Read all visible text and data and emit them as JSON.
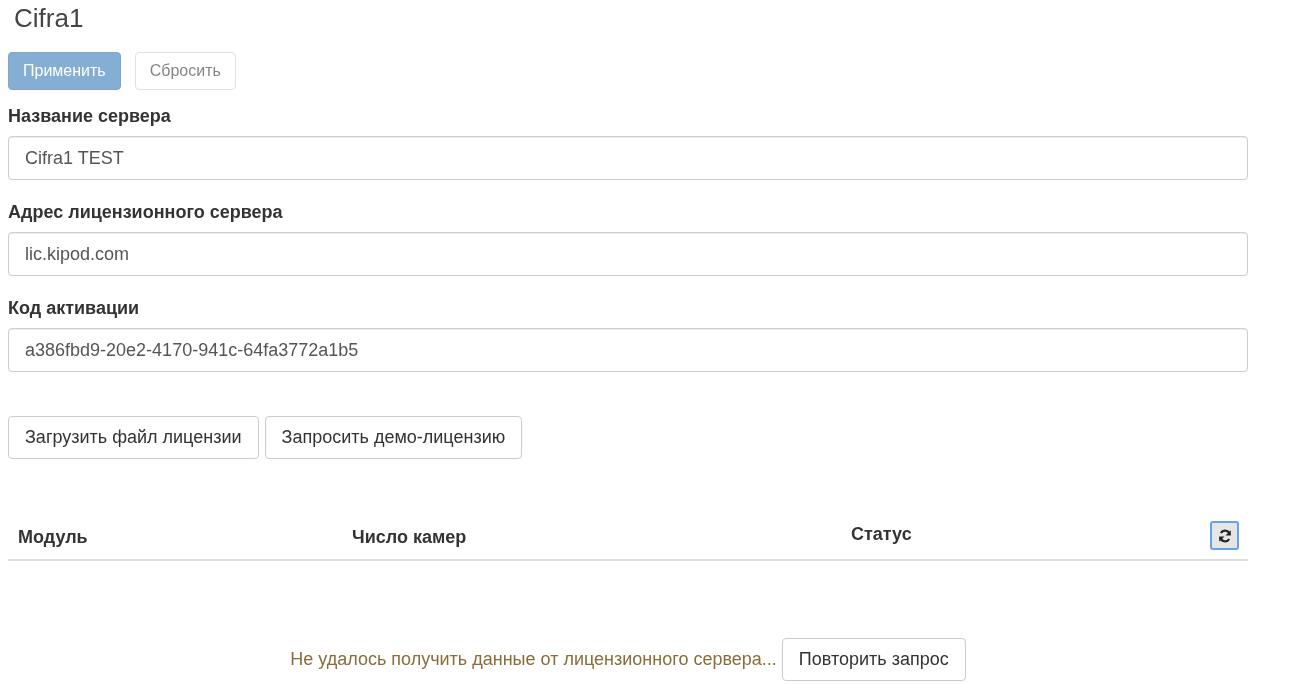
{
  "title": "Cifra1",
  "actions": [
    {
      "label": "Применить",
      "kind": "primary",
      "disabled": true
    },
    {
      "label": "Сбросить",
      "kind": "default",
      "disabled": true
    }
  ],
  "fields": [
    {
      "label": "Название сервера",
      "value": "Cifra1 TEST"
    },
    {
      "label": "Адрес лицензионного сервера",
      "value": "lic.kipod.com"
    },
    {
      "label": "Код активации",
      "value": "a386fbd9-20e2-4170-941c-64fa3772a1b5"
    }
  ],
  "license_buttons": [
    "Загрузить файл лицензии",
    "Запросить демо-лицензию"
  ],
  "table": {
    "columns": [
      "Модуль",
      "Число камер",
      "Статус"
    ]
  },
  "status": {
    "message": "Не удалось получить данные от лицензионного сервера...",
    "retry_button": "Повторить запрос"
  }
}
